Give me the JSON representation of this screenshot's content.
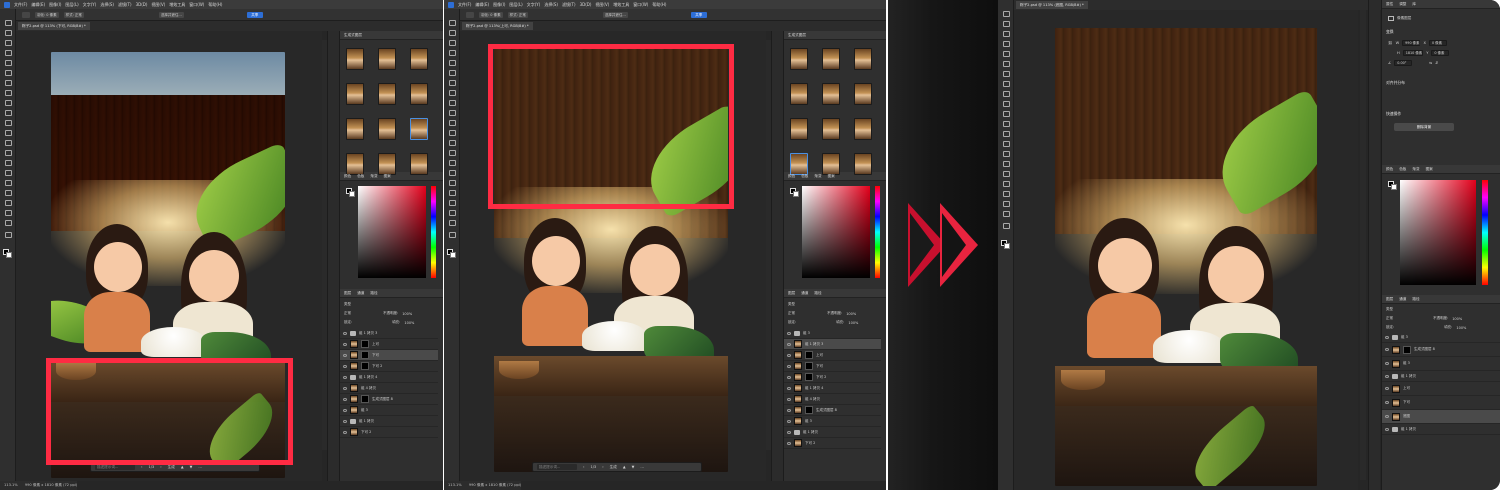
{
  "menu": {
    "items": [
      "文件(F)",
      "编辑(E)",
      "图像(I)",
      "图层(L)",
      "文字(Y)",
      "选择(S)",
      "滤镜(T)",
      "3D(D)",
      "视图(V)",
      "增效工具",
      "窗口(W)",
      "帮助(H)"
    ]
  },
  "options": {
    "feather_label": "羽化: 0 像素",
    "style_label": "样式: 正常",
    "select_subject": "选择并遮住...",
    "share": "共享"
  },
  "left_window": {
    "tab": "粽子2.psd @ 113% (下可, RGB/8#) *",
    "status": "113.1%",
    "status_info": "990 像素 x 1810 像素 (72 ppi)"
  },
  "middle_window": {
    "tab": "粽子2.psd @ 113%(上可, RGB/8#) *",
    "status": "113.1%",
    "status_info": "990 像素 x 1810 像素 (72 ppi)"
  },
  "right_window": {
    "tab": "粽子2.psd @ 113% (底图, RGB/8#) *"
  },
  "panels": {
    "generate_title": "生成式图层",
    "color_tabs": [
      "颜色",
      "色板",
      "渐变",
      "图案"
    ],
    "layers_tabs": [
      "图层",
      "通道",
      "路径"
    ],
    "properties_tabs": [
      "属性",
      "调整",
      "库"
    ],
    "kind_label": "类型",
    "blend_mode": "正常",
    "opacity_label": "不透明度:",
    "opacity_value": "100%",
    "lock_label": "锁定:",
    "fill_label": "填充:",
    "fill_value": "100%"
  },
  "contextual_bar": {
    "prompt_placeholder": "描述提示词...",
    "page": "1/3",
    "generate": "生成"
  },
  "layers_left": [
    {
      "name": "组 1 拷贝 3",
      "type": "group"
    },
    {
      "name": "上可",
      "type": "mask"
    },
    {
      "name": "下可",
      "type": "mask",
      "active": true
    },
    {
      "name": "下可 2",
      "type": "mask"
    },
    {
      "name": "组 1 拷贝 4",
      "type": "group"
    },
    {
      "name": "组 4 拷贝",
      "type": "layer"
    },
    {
      "name": "生成式图层 8",
      "type": "mask"
    },
    {
      "name": "组 3",
      "type": "layer"
    },
    {
      "name": "组 1 拷贝",
      "type": "group"
    },
    {
      "name": "下可 2",
      "type": "layer"
    }
  ],
  "layers_middle": [
    {
      "name": "组 3",
      "type": "group"
    },
    {
      "name": "组 1 拷贝 3",
      "type": "layer",
      "active": true
    },
    {
      "name": "上可",
      "type": "mask"
    },
    {
      "name": "下可",
      "type": "mask"
    },
    {
      "name": "下可 2",
      "type": "mask"
    },
    {
      "name": "组 1 拷贝 4",
      "type": "layer"
    },
    {
      "name": "组 4 拷贝",
      "type": "layer"
    },
    {
      "name": "生成式图层 8",
      "type": "mask"
    },
    {
      "name": "组 3",
      "type": "layer"
    },
    {
      "name": "组 1 拷贝",
      "type": "group"
    },
    {
      "name": "下可 2",
      "type": "layer"
    }
  ],
  "layers_right": [
    {
      "name": "组 3",
      "type": "group"
    },
    {
      "name": "生成式图层 8",
      "type": "mask"
    },
    {
      "name": "组 3",
      "type": "layer"
    },
    {
      "name": "组 1 拷贝",
      "type": "group"
    },
    {
      "name": "上可",
      "type": "layer"
    },
    {
      "name": "下可",
      "type": "layer"
    },
    {
      "name": "底图",
      "type": "layer",
      "active": true
    },
    {
      "name": "组 1 拷贝",
      "type": "group"
    }
  ],
  "properties": {
    "pixel_layer_label": "像素图层",
    "transform_title": "变换",
    "w_label": "W",
    "w_value": "990 像素",
    "x_label": "X",
    "x_value": "0 像素",
    "h_label": "H",
    "h_value": "1810 像素",
    "y_label": "Y",
    "y_value": "0 像素",
    "angle_value": "0.00°",
    "align_title": "对齐并分布",
    "quick_title": "快速操作",
    "remove_bg": "删除背景"
  },
  "colors": {
    "highlight": "#ff2b43",
    "ps_blue": "#2d6ed6"
  }
}
